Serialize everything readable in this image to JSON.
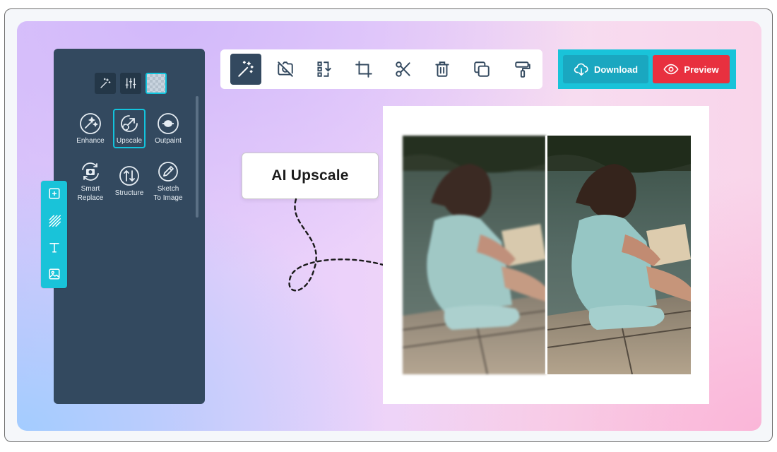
{
  "canvas": {
    "accent": "#19c3d9",
    "panel_color": "#33495f"
  },
  "panel": {
    "tabs": [
      {
        "icon": "magic-wand-icon",
        "active": false
      },
      {
        "icon": "sliders-icon",
        "active": false
      },
      {
        "icon": "transparent-background-icon",
        "active": true
      }
    ],
    "tools": [
      {
        "label": "Enhance",
        "icon": "enhance-sparkle-icon",
        "selected": false
      },
      {
        "label": "Upscale",
        "icon": "upscale-arrow-icon",
        "selected": true
      },
      {
        "label": "Outpaint",
        "icon": "outpaint-icon",
        "selected": false
      },
      {
        "label": "Smart\nReplace",
        "icon": "camera-replace-icon",
        "selected": false
      },
      {
        "label": "Structure",
        "icon": "structure-icon",
        "selected": false
      },
      {
        "label": "Sketch\nTo Image",
        "icon": "pencil-icon",
        "selected": false
      }
    ]
  },
  "strip": {
    "items": [
      "add-square-icon",
      "pattern-icon",
      "text-icon",
      "image-icon"
    ]
  },
  "toolbar": {
    "items": [
      {
        "icon": "magic-wand-icon",
        "active": true
      },
      {
        "icon": "no-camera-icon",
        "active": false
      },
      {
        "icon": "resize-icon",
        "active": false
      },
      {
        "icon": "crop-icon",
        "active": false
      },
      {
        "icon": "scissors-icon",
        "active": false
      },
      {
        "icon": "trash-icon",
        "active": false
      },
      {
        "icon": "duplicate-icon",
        "active": false
      },
      {
        "icon": "paint-roller-icon",
        "active": false
      }
    ]
  },
  "actions": {
    "download_label": "Download",
    "preview_label": "Preview",
    "download_color": "#1aa7c0",
    "preview_color": "#e8303f"
  },
  "callout": {
    "text": "AI Upscale"
  },
  "comparison": {
    "before": "blurred-photo-woman-reading",
    "after": "upscaled-photo-woman-reading"
  }
}
